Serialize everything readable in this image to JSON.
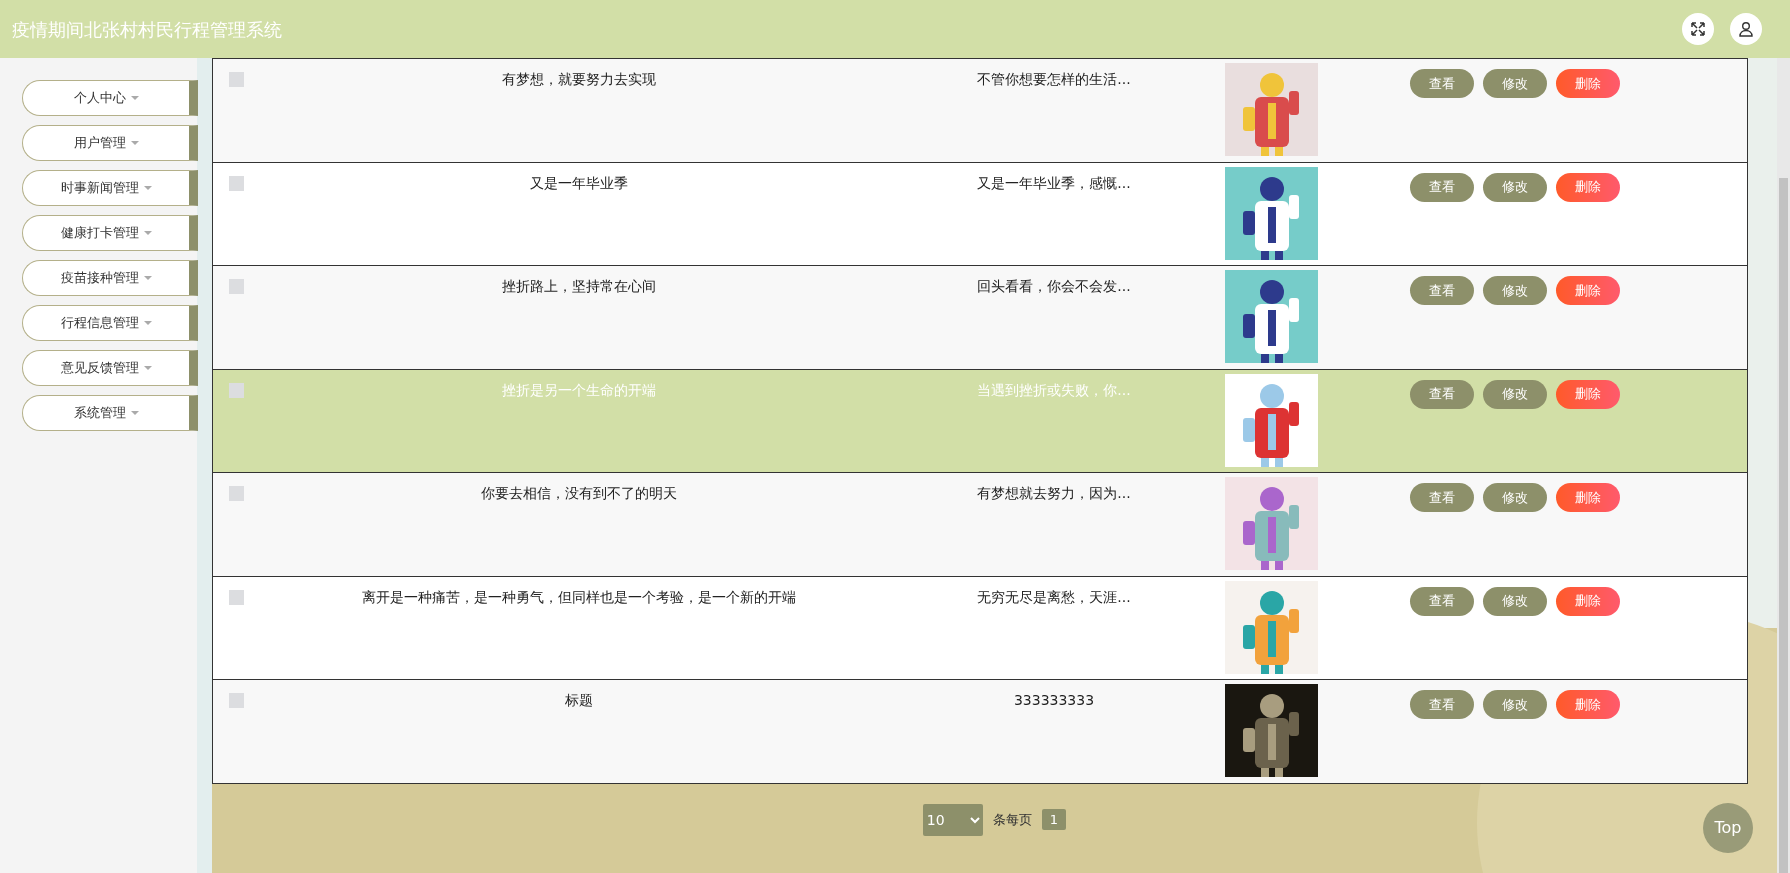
{
  "header": {
    "title": "疫情期间北张村村民行程管理系统"
  },
  "sidebar": {
    "items": [
      {
        "label": "个人中心"
      },
      {
        "label": "用户管理"
      },
      {
        "label": "时事新闻管理"
      },
      {
        "label": "健康打卡管理"
      },
      {
        "label": "疫苗接种管理"
      },
      {
        "label": "行程信息管理"
      },
      {
        "label": "意见反馈管理"
      },
      {
        "label": "系统管理"
      }
    ]
  },
  "table": {
    "rows": [
      {
        "checked": false,
        "selected": false,
        "title": "有梦想，就要努力去实现",
        "content": "不管你想要怎样的生活...",
        "actions": [
          "查看",
          "修改",
          "删除"
        ]
      },
      {
        "checked": false,
        "selected": false,
        "title": "又是一年毕业季",
        "content": "又是一年毕业季，感慨...",
        "actions": [
          "查看",
          "修改",
          "删除"
        ]
      },
      {
        "checked": false,
        "selected": false,
        "title": "挫折路上，坚持常在心间",
        "content": "回头看看，你会不会发...",
        "actions": [
          "查看",
          "修改",
          "删除"
        ]
      },
      {
        "checked": false,
        "selected": true,
        "title": "挫折是另一个生命的开端",
        "content": "当遇到挫折或失败，你...",
        "actions": [
          "查看",
          "修改",
          "删除"
        ]
      },
      {
        "checked": false,
        "selected": false,
        "title": "你要去相信，没有到不了的明天",
        "content": "有梦想就去努力，因为...",
        "actions": [
          "查看",
          "修改",
          "删除"
        ]
      },
      {
        "checked": false,
        "selected": false,
        "title": "离开是一种痛苦，是一种勇气，但同样也是一个考验，是一个新的开端",
        "content": "无穷无尽是离愁，天涯...",
        "actions": [
          "查看",
          "修改",
          "删除"
        ]
      },
      {
        "checked": false,
        "selected": false,
        "title": "标题",
        "content": "333333333",
        "actions": [
          "查看",
          "修改",
          "删除"
        ]
      }
    ]
  },
  "pagination": {
    "page_size": "10",
    "per_page_label": "条每页",
    "pages": [
      {
        "label": "1",
        "selected": true
      }
    ]
  },
  "back_to_top": "Top"
}
